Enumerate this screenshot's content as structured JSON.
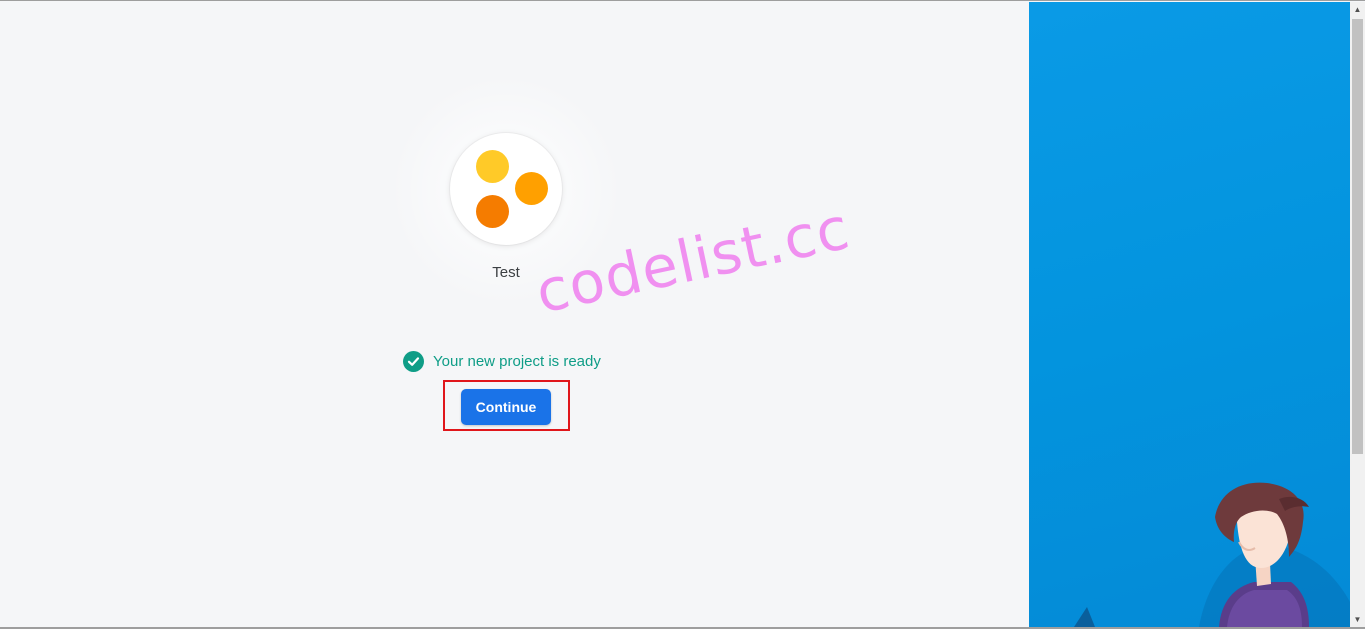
{
  "project": {
    "name": "Test",
    "logo_colors": [
      "#ffca28",
      "#ffa000",
      "#f57c00"
    ]
  },
  "status": {
    "text": "Your new project is ready",
    "icon": "check-circle-icon",
    "color": "#0f9d87"
  },
  "actions": {
    "continue_label": "Continue",
    "accent": "#1a73e8"
  },
  "watermark": {
    "text": "codelist.cc"
  },
  "scrollbar": {
    "up_glyph": "▲",
    "down_glyph": "▼"
  }
}
